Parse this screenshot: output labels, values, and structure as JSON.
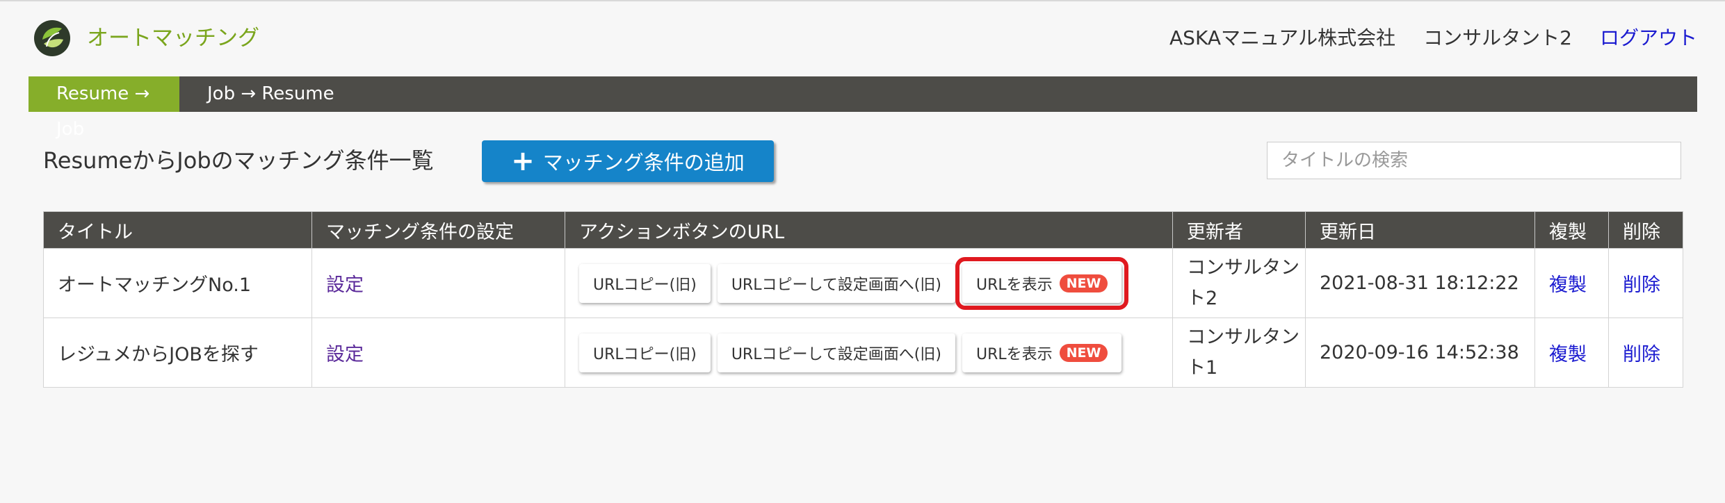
{
  "header": {
    "app_title": "オートマッチング",
    "company": "ASKAマニュアル株式会社",
    "user": "コンサルタント2",
    "logout": "ログアウト"
  },
  "nav": {
    "tabs": [
      {
        "label": "Resume → Job",
        "active": true
      },
      {
        "label": "Job → Resume",
        "active": false
      }
    ]
  },
  "toolbar": {
    "page_title": "ResumeからJobのマッチング条件一覧",
    "add_button_label": "マッチング条件の追加",
    "search_placeholder": "タイトルの検索"
  },
  "table": {
    "headers": [
      "タイトル",
      "マッチング条件の設定",
      "アクションボタンのURL",
      "更新者",
      "更新日",
      "複製",
      "削除"
    ],
    "rows": [
      {
        "title": "オートマッチングNo.1",
        "settings": "設定",
        "btn_copy_old": "URLコピー(旧)",
        "btn_copy_settings": "URLコピーして設定画面へ(旧)",
        "btn_show": "URLを表示",
        "badge": "NEW",
        "updater_line1": "コンサルタン",
        "updater_line2": "ト2",
        "updated": "2021-08-31 18:12:22",
        "duplicate": "複製",
        "delete": "削除"
      },
      {
        "title": "レジュメからJOBを探す",
        "settings": "設定",
        "btn_copy_old": "URLコピー(旧)",
        "btn_copy_settings": "URLコピーして設定画面へ(旧)",
        "btn_show": "URLを表示",
        "badge": "NEW",
        "updater_line1": "コンサルタン",
        "updater_line2": "ト1",
        "updated": "2020-09-16 14:52:38",
        "duplicate": "複製",
        "delete": "削除"
      }
    ]
  },
  "colors": {
    "accent_green": "#86ae2a",
    "nav_dark": "#4d4c48",
    "primary_blue": "#1584c9",
    "link_blue": "#1b1bd0",
    "highlight_red": "#e0191f",
    "badge_red": "#ef4d3e"
  }
}
